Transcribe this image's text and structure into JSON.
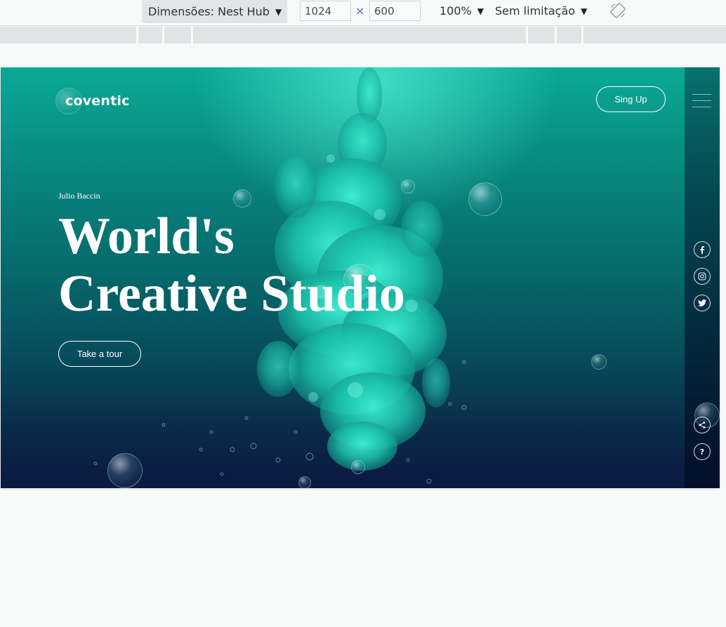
{
  "devtools": {
    "device_label": "Dimensões: Nest Hub",
    "width_value": "1024",
    "height_value": "600",
    "times_symbol": "×",
    "zoom_label": "100%",
    "throttle_label": "Sem limitação",
    "caret": "▼",
    "icons": [
      "chevron-down-icon",
      "rotate-icon"
    ]
  },
  "site": {
    "brand": "coventic",
    "signup_label": "Sing Up",
    "author": "Julio Baccin",
    "headline_line1": "World's",
    "headline_line2": "Creative Studio",
    "cta_label": "Take a tour",
    "social_icons": [
      "facebook-icon",
      "instagram-icon",
      "twitter-icon"
    ],
    "utility_icons": [
      "share-icon",
      "help-icon"
    ],
    "help_glyph": "?",
    "colors": {
      "accent_teal": "#13e0c4",
      "bg_top": "#0aa996",
      "bg_bottom": "#0b1740",
      "text": "#ffffff"
    }
  }
}
